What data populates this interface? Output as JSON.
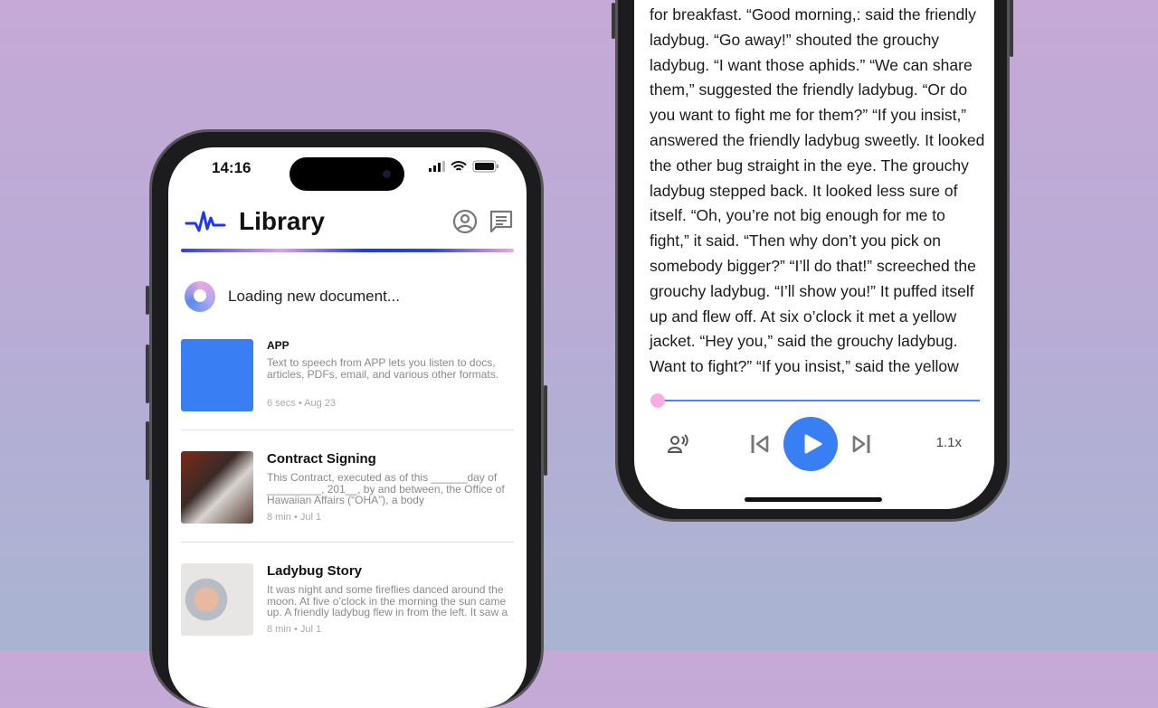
{
  "left_phone": {
    "status": {
      "time": "14:16"
    },
    "header": {
      "title": "Library",
      "icons": [
        "waveform-logo-icon",
        "account-icon",
        "chat-icon"
      ]
    },
    "loading_text": "Loading new document...",
    "documents": [
      {
        "title": "APP",
        "description": "Text to speech from APP lets you listen to docs, articles, PDFs, email, and various other formats.",
        "meta": "6 secs • Aug 23",
        "thumb_color": "#3a7ef4"
      },
      {
        "title": "Contract Signing",
        "description": "This Contract, executed as of this ______day of _________, 201__, by and between, the Office of Hawaiian Affairs (“OHA”), a body",
        "meta": "8 min • Jul 1"
      },
      {
        "title": "Ladybug Story",
        "description": "It was night and some fireflies danced around the moon. At five o’clock in the morning the sun came up. A friendly ladybug flew in from the left. It saw a",
        "meta": "8 min • Jul 1"
      }
    ]
  },
  "right_phone": {
    "story_text": "for breakfast. “Good morning,: said the friendly ladybug. “Go away!” shouted the grouchy ladybug. “I want those aphids.” “We can share them,” suggested the friendly ladybug. “Or do you want to fight me for them?” “If you insist,” answered the friendly ladybug sweetly. It looked the other bug straight in the eye. The grouchy ladybug stepped back. It looked less sure of itself. “Oh, you’re not big enough for me to fight,” it said. “Then why don’t you pick on somebody bigger?” “I’ll do that!” screeched the grouchy ladybug. “I’ll show you!” It puffed itself up and flew off. At six o’clock it met a yellow jacket. “Hey you,” said the grouchy ladybug. Want to fight?” “If you insist,” said the yellow",
    "player": {
      "progress": 0.0,
      "speed": "1.1x",
      "icons": [
        "voice-icon",
        "skip-back-icon",
        "play-icon",
        "skip-forward-icon"
      ]
    },
    "colors": {
      "accent": "#387ff4",
      "knob": "#f6aee0"
    }
  }
}
